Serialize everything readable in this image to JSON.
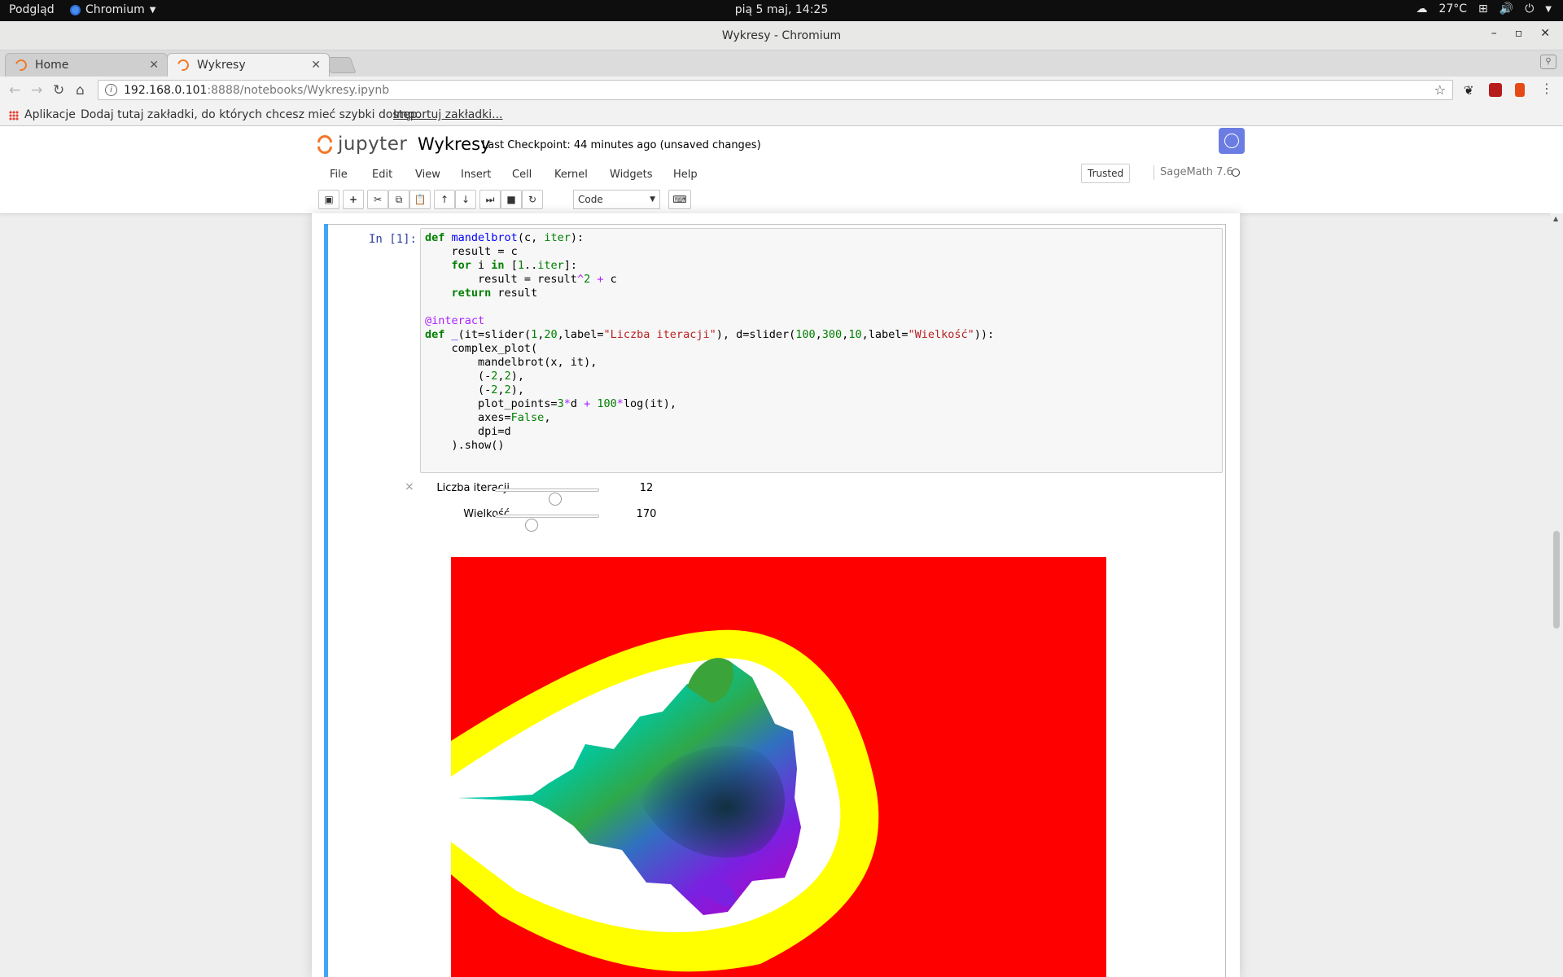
{
  "gnome": {
    "activities": "Podgląd",
    "app_menu": "Chromium",
    "clock": "pią 5 maj, 14:25",
    "temperature": "27°C",
    "icons": [
      "weather-icon",
      "network-icon",
      "volume-icon",
      "power-icon"
    ]
  },
  "window": {
    "title": "Wykresy - Chromium",
    "controls": [
      "minimize-icon",
      "maximize-icon",
      "close-icon"
    ]
  },
  "tabs": [
    {
      "title": "Home",
      "active": false
    },
    {
      "title": "Wykresy",
      "active": true
    }
  ],
  "omnibox": {
    "host": "192.168.0.101",
    "path": ":8888/notebooks/Wykresy.ipynb"
  },
  "bookmarks": {
    "apps_label": "Aplikacje",
    "hint": "Dodaj tutaj zakładki, do których chcesz mieć szybki dostęp.",
    "import_link": "Importuj zakładki..."
  },
  "jupyter": {
    "logo_text": "jupyter",
    "notebook_title": "Wykresy",
    "checkpoint": "Last Checkpoint: 44 minutes ago (unsaved changes)",
    "menu": [
      "File",
      "Edit",
      "View",
      "Insert",
      "Cell",
      "Kernel",
      "Widgets",
      "Help"
    ],
    "trusted": "Trusted",
    "kernel": "SageMath 7.6",
    "cell_type": "Code",
    "toolbar_icons": [
      "save-icon",
      "add-cell-icon",
      "cut-icon",
      "copy-icon",
      "paste-icon",
      "move-up-icon",
      "move-down-icon",
      "run-icon",
      "stop-icon",
      "restart-icon",
      "keyboard-icon"
    ]
  },
  "cell": {
    "prompt": "In [1]:",
    "language": "sage",
    "code_lines": [
      "def mandelbrot(c, iter):",
      "    result = c",
      "    for i in [1..iter]:",
      "        result = result^2 + c",
      "    return result",
      "",
      "@interact",
      "def _(it=slider(1,20,label=\"Liczba iteracji\"), d=slider(100,300,10,label=\"Wielkość\")):",
      "    complex_plot(",
      "        mandelbrot(x, it),",
      "        (-2,2),",
      "        (-2,2),",
      "        plot_points=3*d + 100*log(it),",
      "        axes=False,",
      "        dpi=d",
      "    ).show()"
    ]
  },
  "widgets": {
    "sliders": [
      {
        "label": "Liczba iteracji",
        "value": "12",
        "min": 1,
        "max": 20,
        "fraction": 0.58
      },
      {
        "label": "Wielkość",
        "value": "170",
        "min": 100,
        "max": 300,
        "fraction": 0.35
      }
    ],
    "close_glyph": "×"
  },
  "plot": {
    "description_colors": {
      "outer": "#ff0000",
      "band": "#ffff00",
      "inner": "#ffffff"
    }
  }
}
